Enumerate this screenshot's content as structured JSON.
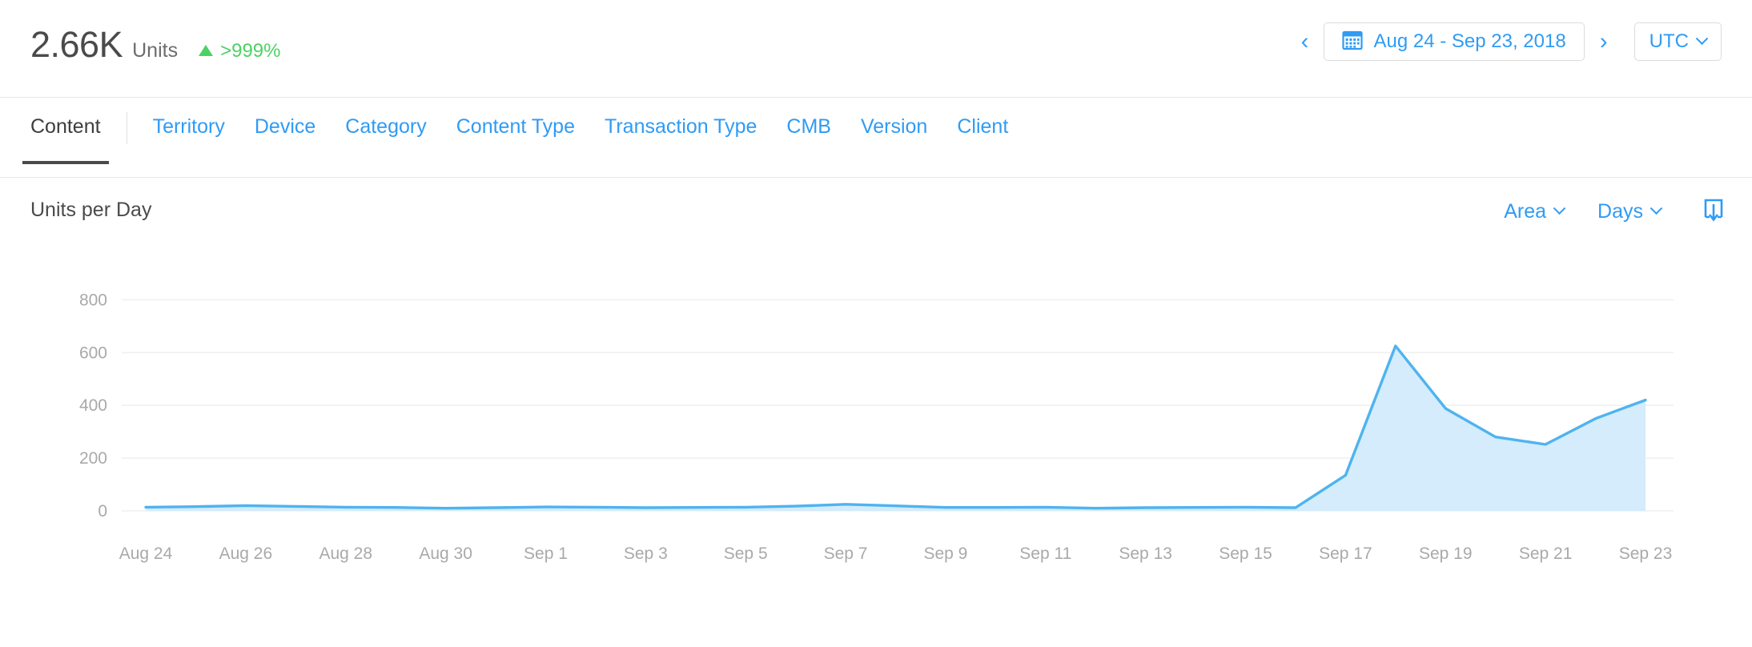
{
  "header": {
    "kpi_value": "2.66K",
    "kpi_unit": "Units",
    "kpi_delta": ">999%",
    "delta_direction": "up",
    "delta_color": "#4cd263",
    "date_range": "Aug 24 - Sep 23, 2018",
    "prev_label": "‹",
    "next_label": "›",
    "timezone": "UTC",
    "calendar_icon": "calendar-icon"
  },
  "tabs": [
    {
      "label": "Content",
      "active": true
    },
    {
      "label": "Territory",
      "active": false
    },
    {
      "label": "Device",
      "active": false
    },
    {
      "label": "Category",
      "active": false
    },
    {
      "label": "Content Type",
      "active": false
    },
    {
      "label": "Transaction Type",
      "active": false
    },
    {
      "label": "CMB",
      "active": false
    },
    {
      "label": "Version",
      "active": false
    },
    {
      "label": "Client",
      "active": false
    }
  ],
  "chart_toolbar": {
    "title": "Units per Day",
    "chart_type": "Area",
    "interval": "Days",
    "export_icon": "export-download-icon"
  },
  "chart_data": {
    "type": "area",
    "title": "Units per Day",
    "xlabel": "",
    "ylabel": "",
    "ylim": [
      0,
      880
    ],
    "yticks": [
      0,
      200,
      400,
      600,
      800
    ],
    "ytick_labels": [
      "0",
      "200",
      "400",
      "600",
      "800"
    ],
    "grid": true,
    "legend": false,
    "line_color": "#4fb3ef",
    "fill_color": "#d4ecfb",
    "x": [
      "Aug 24",
      "Aug 25",
      "Aug 26",
      "Aug 27",
      "Aug 28",
      "Aug 29",
      "Aug 30",
      "Aug 31",
      "Sep 1",
      "Sep 2",
      "Sep 3",
      "Sep 4",
      "Sep 5",
      "Sep 6",
      "Sep 7",
      "Sep 8",
      "Sep 9",
      "Sep 10",
      "Sep 11",
      "Sep 12",
      "Sep 13",
      "Sep 14",
      "Sep 15",
      "Sep 16",
      "Sep 17",
      "Sep 18",
      "Sep 19",
      "Sep 20",
      "Sep 21",
      "Sep 22",
      "Sep 23"
    ],
    "xtick_labels": [
      "Aug 24",
      "Aug 26",
      "Aug 28",
      "Aug 30",
      "Sep 1",
      "Sep 3",
      "Sep 5",
      "Sep 7",
      "Sep 9",
      "Sep 11",
      "Sep 13",
      "Sep 15",
      "Sep 17",
      "Sep 19",
      "Sep 21",
      "Sep 23"
    ],
    "values": [
      14,
      16,
      20,
      17,
      14,
      13,
      10,
      12,
      15,
      14,
      12,
      13,
      14,
      18,
      25,
      19,
      13,
      13,
      14,
      10,
      12,
      13,
      14,
      12,
      135,
      625,
      388,
      280,
      252,
      350,
      420
    ]
  }
}
